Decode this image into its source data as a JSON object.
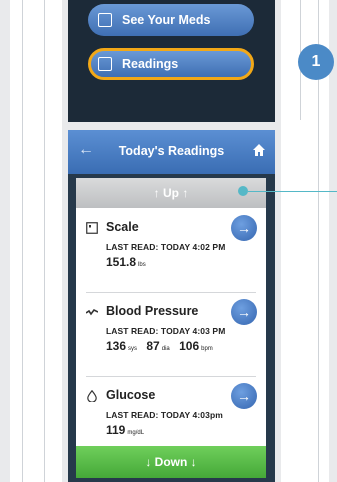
{
  "top_menu": {
    "items": [
      {
        "label": "See Your Meds",
        "icon": "pill-box-icon",
        "selected": false
      },
      {
        "label": "Readings",
        "icon": "clipboard-icon",
        "selected": true
      }
    ],
    "callout": "1",
    "colors": {
      "button": "#4f82c6",
      "selected_border": "#f2a817",
      "callout": "#4b8ac7"
    }
  },
  "screen": {
    "title": "Today's Readings",
    "back_icon": "back-arrow-icon",
    "home_icon": "home-icon",
    "up_label": "↑  Up  ↑",
    "down_label": "↓  Down  ↓",
    "readings": [
      {
        "name": "Scale",
        "icon": "scale-icon",
        "last_read": "LAST READ:  TODAY 4:02 PM",
        "values": [
          {
            "value": "151.8",
            "unit": "lbs"
          }
        ]
      },
      {
        "name": "Blood Pressure",
        "icon": "pulse-icon",
        "last_read": "LAST READ:  TODAY 4:03 PM",
        "values": [
          {
            "value": "136",
            "unit": "sys"
          },
          {
            "value": "87",
            "unit": "dia"
          },
          {
            "value": "106",
            "unit": "bpm"
          }
        ]
      },
      {
        "name": "Glucose",
        "icon": "drop-icon",
        "last_read": "LAST READ:  TODAY 4:03pm",
        "values": [
          {
            "value": "119",
            "unit": "mg/dL"
          }
        ]
      }
    ],
    "colors": {
      "titlebar": "#4a7ec3",
      "down_bar": "#59bd47",
      "up_bar": "#c9cbcd",
      "leader": "#55b8c7"
    }
  }
}
